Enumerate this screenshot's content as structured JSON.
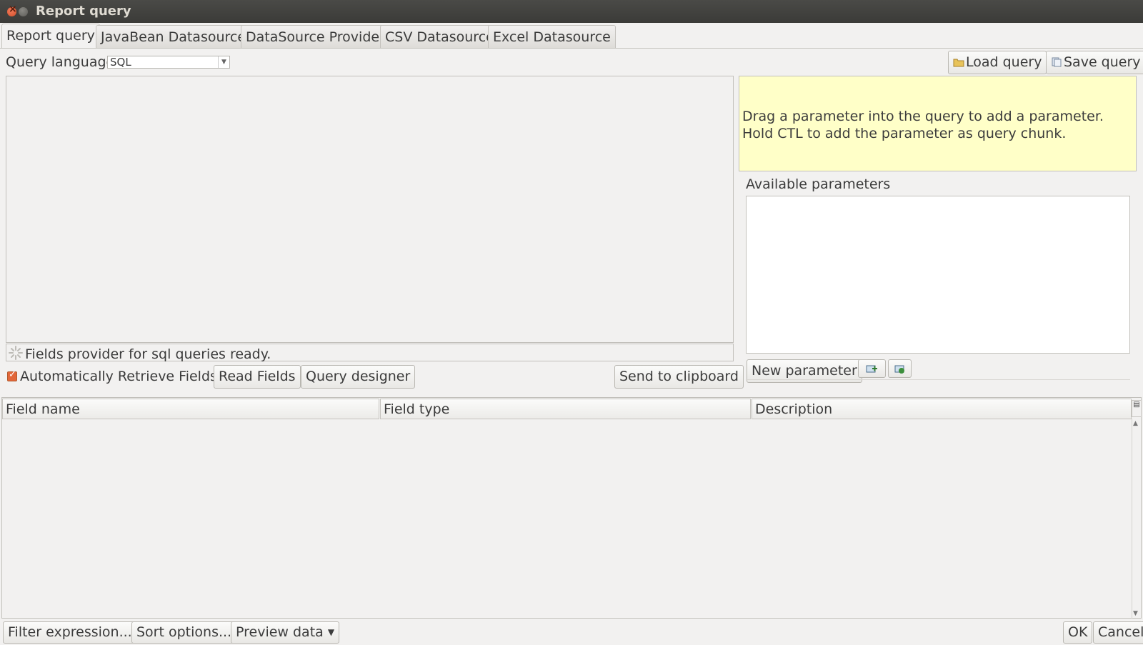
{
  "window": {
    "title": "Report query"
  },
  "tabs": [
    {
      "label": "Report query",
      "active": true
    },
    {
      "label": "JavaBean Datasource"
    },
    {
      "label": "DataSource Provider"
    },
    {
      "label": "CSV Datasource"
    },
    {
      "label": "Excel Datasource"
    }
  ],
  "query": {
    "language_label": "Query language",
    "language_value": "SQL",
    "load_label": "Load query",
    "save_label": "Save query",
    "status": "Fields provider for sql queries ready.",
    "auto_retrieve_label": "Automatically Retrieve Fields",
    "auto_retrieve_checked": true,
    "read_fields_label": "Read Fields",
    "designer_label": "Query designer",
    "clipboard_label": "Send to clipboard"
  },
  "parameters": {
    "hint": "Drag a parameter into the query to add a parameter. Hold CTL to add the parameter as query chunk.",
    "available_label": "Available parameters",
    "new_label": "New parameter"
  },
  "fields_table": {
    "columns": [
      "Field name",
      "Field type",
      "Description"
    ]
  },
  "bottom": {
    "filter_label": "Filter expression...",
    "sort_label": "Sort options...",
    "preview_label": "Preview data",
    "ok_label": "OK",
    "cancel_label": "Cancel"
  },
  "colors": {
    "hint_bg": "#ffffc8",
    "titlebar": "#3c3b37",
    "checkbox": "#e2673a"
  }
}
